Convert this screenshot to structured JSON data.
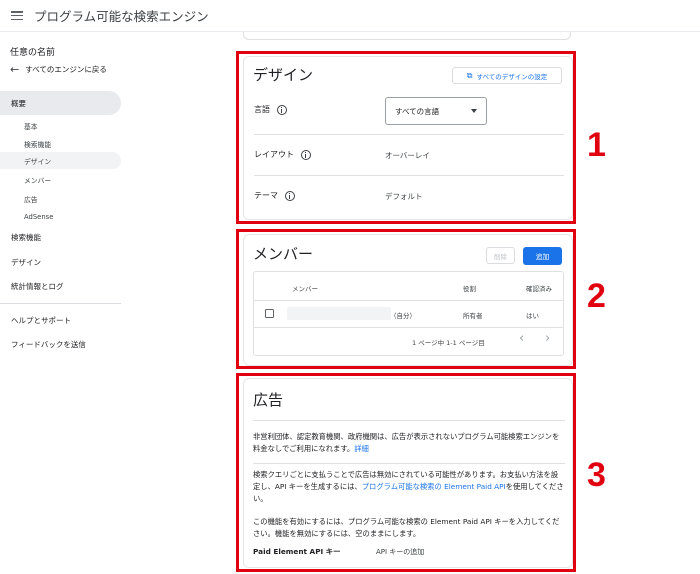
{
  "header": {
    "title": "プログラム可能な検索エンジン"
  },
  "sidebar": {
    "engine_name": "任意の名前",
    "back_label": "すべてのエンジンに戻る",
    "items": [
      {
        "label": "概要"
      },
      {
        "label": "基本"
      },
      {
        "label": "検索機能"
      },
      {
        "label": "デザイン"
      },
      {
        "label": "メンバー"
      },
      {
        "label": "広告"
      },
      {
        "label": "AdSense"
      },
      {
        "label": "検索機能"
      },
      {
        "label": "デザイン"
      },
      {
        "label": "統計情報とログ"
      },
      {
        "label": "ヘルプとサポート"
      },
      {
        "label": "フィードバックを送信"
      }
    ]
  },
  "design": {
    "title": "デザイン",
    "all_designs_button": "すべてのデザインの設定",
    "language_label": "言語",
    "language_value": "すべての言語",
    "layout_label": "レイアウト",
    "layout_value": "オーバーレイ",
    "theme_label": "テーマ",
    "theme_value": "デフォルト"
  },
  "members": {
    "title": "メンバー",
    "delete_button": "削除",
    "add_button": "追加",
    "columns": [
      "メンバー",
      "役割",
      "確認済み"
    ],
    "rows": [
      {
        "suffix": "（自分）",
        "role": "所有者",
        "verified": "はい"
      }
    ],
    "pagination": "1 ページ中 1-1 ページ目"
  },
  "ads": {
    "title": "広告",
    "para1": "非営利団体、認定教育機関、政府機関は、広告が表示されないプログラム可能検索エンジンを料金なしでご利用になれます。",
    "para1_link": "詳細",
    "para2_a": "検索クエリごとに支払うことで広告は無効にされている可能性があります。お支払い方法を設定し、API キーを生成するには、",
    "para2_link": "プログラム可能な検索の Element Paid API",
    "para2_b": "を使用してください。",
    "para3": "この機能を有効にするには、プログラム可能な検索の Element Paid API キーを入力してください。機能を無効にするには、空のままにします。",
    "key_label": "Paid Element API キー",
    "key_value": "API キーの追加"
  },
  "annotations": [
    "1",
    "2",
    "3"
  ],
  "colors": {
    "accent": "#1a73e8",
    "annotation": "#e0000f"
  }
}
